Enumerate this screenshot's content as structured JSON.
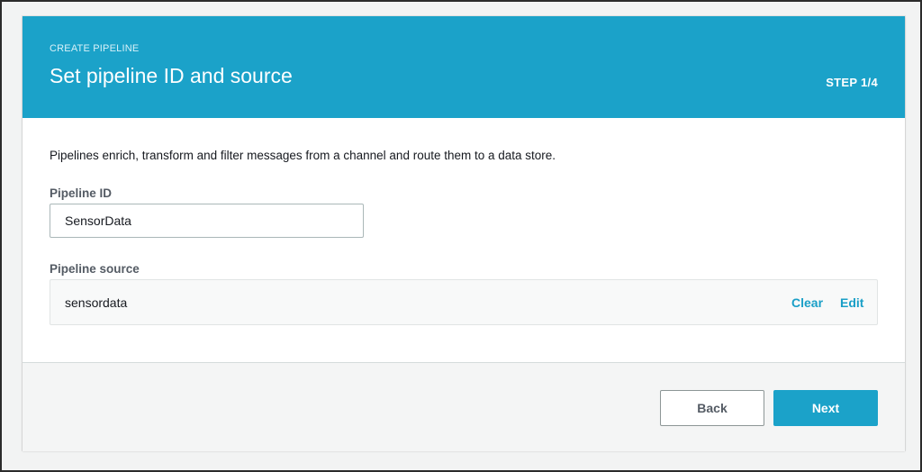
{
  "header": {
    "eyebrow": "CREATE PIPELINE",
    "title": "Set pipeline ID and source",
    "step": "STEP 1/4"
  },
  "description": "Pipelines enrich, transform and filter messages from a channel and route them to a data store.",
  "pipeline_id": {
    "label": "Pipeline ID",
    "value": "SensorData"
  },
  "pipeline_source": {
    "label": "Pipeline source",
    "value": "sensordata",
    "clear_label": "Clear",
    "edit_label": "Edit"
  },
  "footer": {
    "back_label": "Back",
    "next_label": "Next"
  },
  "colors": {
    "accent": "#1ba2c9",
    "link": "#1a9fc7",
    "label_gray": "#545b64"
  }
}
